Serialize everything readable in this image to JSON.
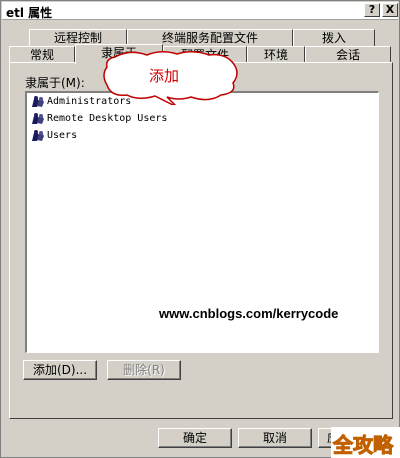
{
  "window": {
    "title": "etl 属性",
    "help_button": "?",
    "close_button": "X"
  },
  "tabs_row1": [
    {
      "label": "远程控制"
    },
    {
      "label": "终端服务配置文件"
    },
    {
      "label": "拨入"
    }
  ],
  "tabs_row2": [
    {
      "label": "常规"
    },
    {
      "label": "隶属于",
      "active": true
    },
    {
      "label": "配置文件"
    },
    {
      "label": "环境"
    },
    {
      "label": "会话"
    }
  ],
  "member_of": {
    "label": "隶属于(M):",
    "items": [
      {
        "name": "Administrators",
        "icon": "group-icon"
      },
      {
        "name": "Remote Desktop Users",
        "icon": "group-icon"
      },
      {
        "name": "Users",
        "icon": "group-icon"
      }
    ]
  },
  "actions": {
    "add_label": "添加(D)...",
    "remove_label": "删除(R)"
  },
  "footer": {
    "ok_label": "确定",
    "cancel_label": "取消",
    "apply_label": "应"
  },
  "overlay": {
    "callout_text": "添加",
    "watermark": "www.cnblogs.com/kerrycode",
    "logo_text": "全攻略"
  },
  "colors": {
    "dialog_bg": "#d4d0c8",
    "callout_text": "#d40000",
    "logo": "#e08a16"
  }
}
